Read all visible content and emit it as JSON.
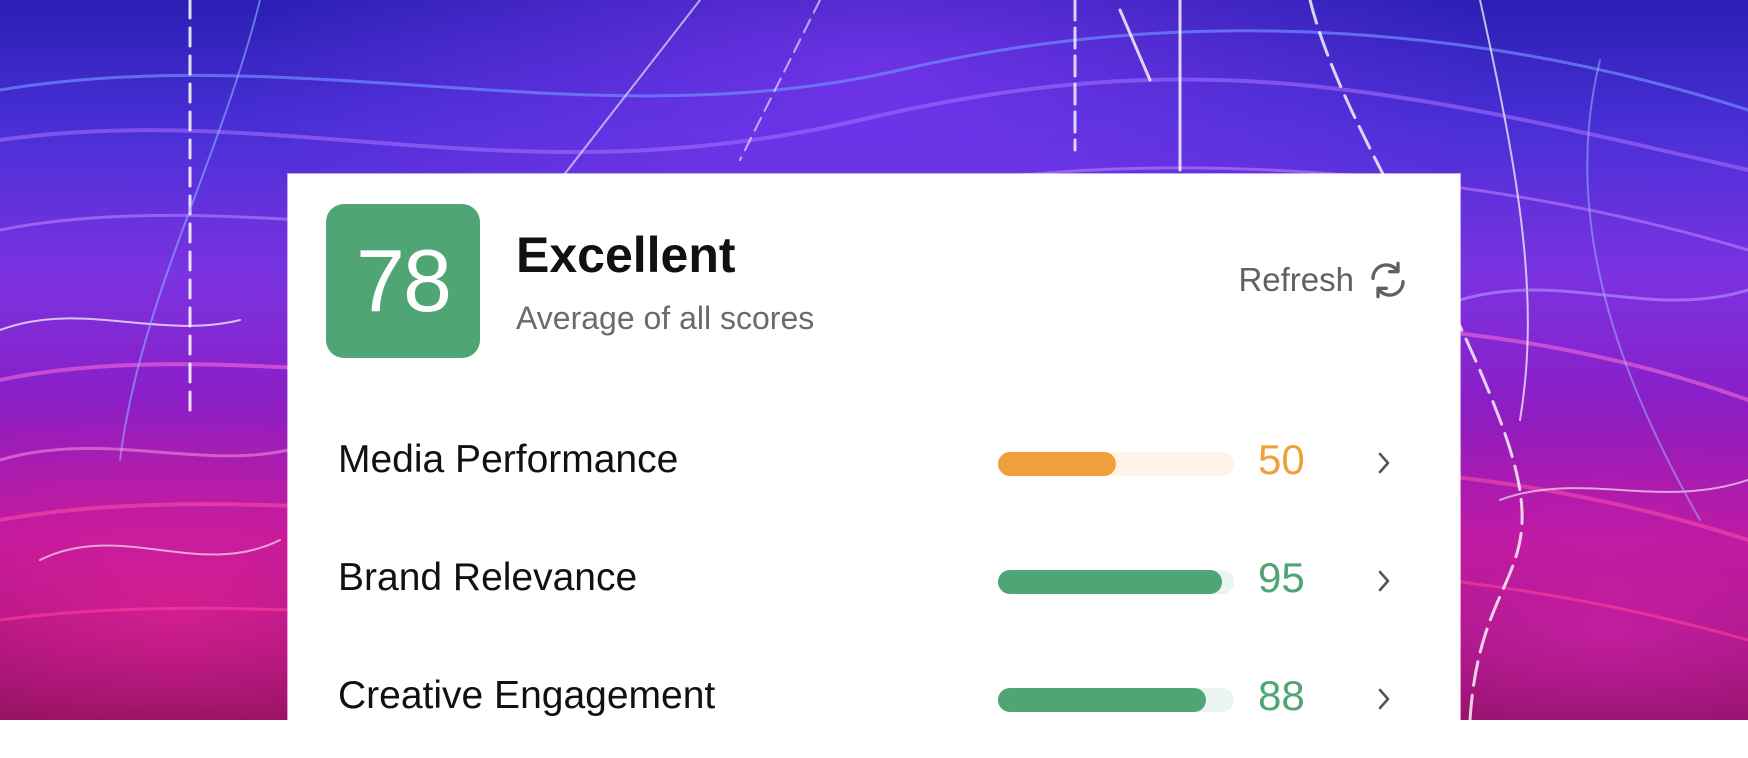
{
  "summary": {
    "score": "78",
    "rating": "Excellent",
    "subtitle": "Average of all scores",
    "badge_color": "#4fa574"
  },
  "refresh": {
    "label": "Refresh",
    "icon": "refresh-icon"
  },
  "metrics": [
    {
      "label": "Media Performance",
      "value": "50",
      "fraction": 0.5,
      "color": "#f0a03a",
      "track_color": "#fdf3e7",
      "icon": "chevron-right-icon"
    },
    {
      "label": "Brand Relevance",
      "value": "95",
      "fraction": 0.95,
      "color": "#4fa574",
      "track_color": "#ebf5ef",
      "icon": "chevron-right-icon"
    },
    {
      "label": "Creative Engagement",
      "value": "88",
      "fraction": 0.88,
      "color": "#4fa574",
      "track_color": "#ebf5ef",
      "icon": "chevron-right-icon"
    }
  ]
}
